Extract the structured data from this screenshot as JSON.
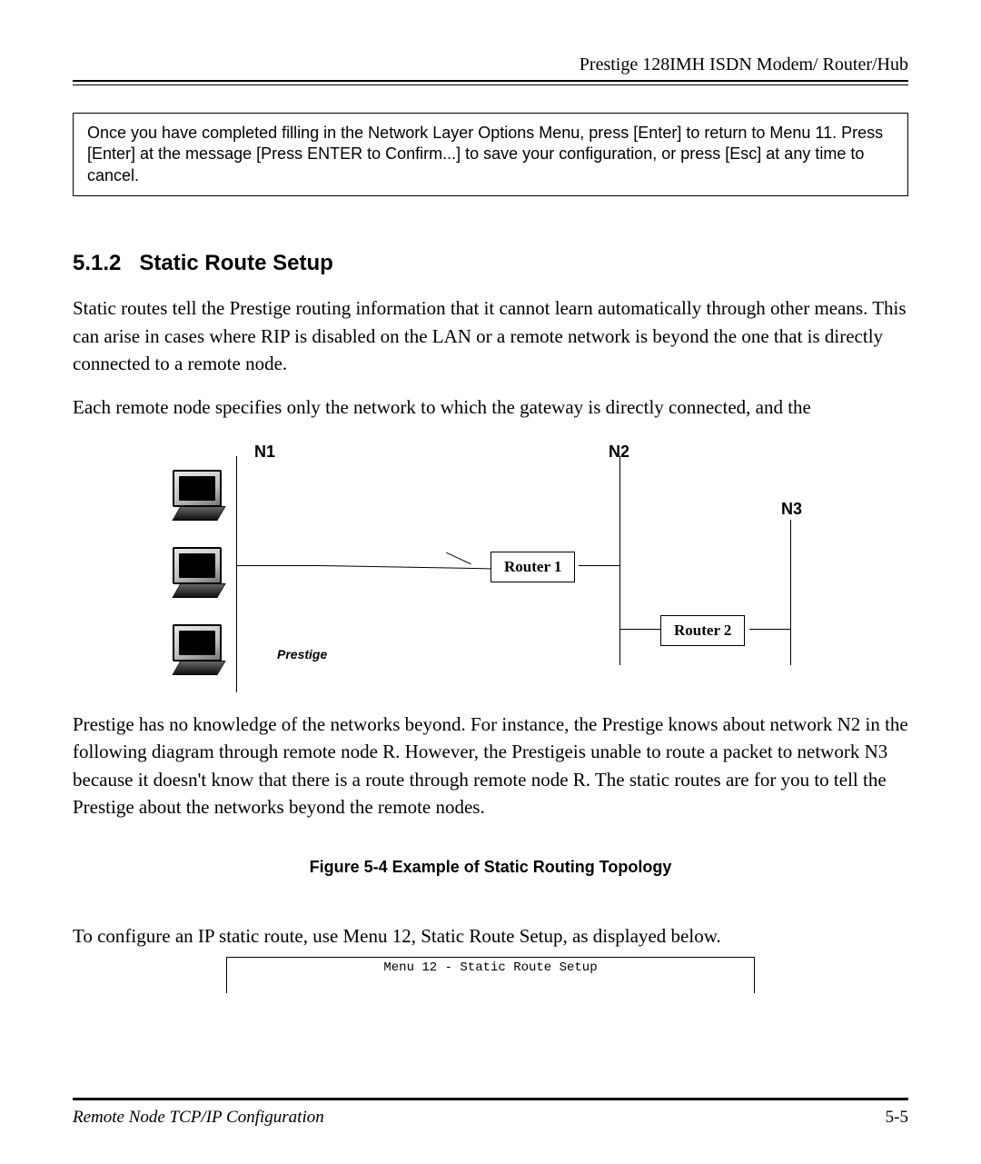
{
  "header": {
    "product": "Prestige 128IMH ISDN Modem/ Router/Hub"
  },
  "info_box": "Once you have completed filling in the Network Layer Options Menu, press [Enter] to return to Menu 11. Press [Enter] at the message [Press ENTER to Confirm...] to save your configuration, or press [Esc] at any time to cancel.",
  "section": {
    "number": "5.1.2",
    "title": "Static Route Setup"
  },
  "para1": "Static routes tell the Prestige routing information that it cannot learn automatically through other means. This can arise in cases where RIP is disabled on the LAN or a remote network is beyond the one that is directly connected to a remote node.",
  "para2": "Each remote node specifies only the network to which the gateway is directly connected, and the",
  "para3": "Prestige has no knowledge of the networks beyond. For instance, the Prestige knows about network N2 in the following diagram through remote node R. However, the Prestigeis unable to route a packet to network N3 because it doesn't know that there is a route through remote node R. The static routes are for you to tell the Prestige about the networks beyond the remote nodes.",
  "figure_caption": "Figure 5-4 Example of Static Routing Topology",
  "para4": "To configure an IP static route, use Menu 12, Static Route Setup, as displayed below.",
  "menu_title": "Menu 12 - Static Route Setup",
  "diagram": {
    "n1": "N1",
    "n2": "N2",
    "n3": "N3",
    "router1": "Router 1",
    "router2": "Router 2",
    "prestige": "Prestige"
  },
  "footer": {
    "left": "Remote Node TCP/IP Configuration",
    "right": "5-5"
  }
}
